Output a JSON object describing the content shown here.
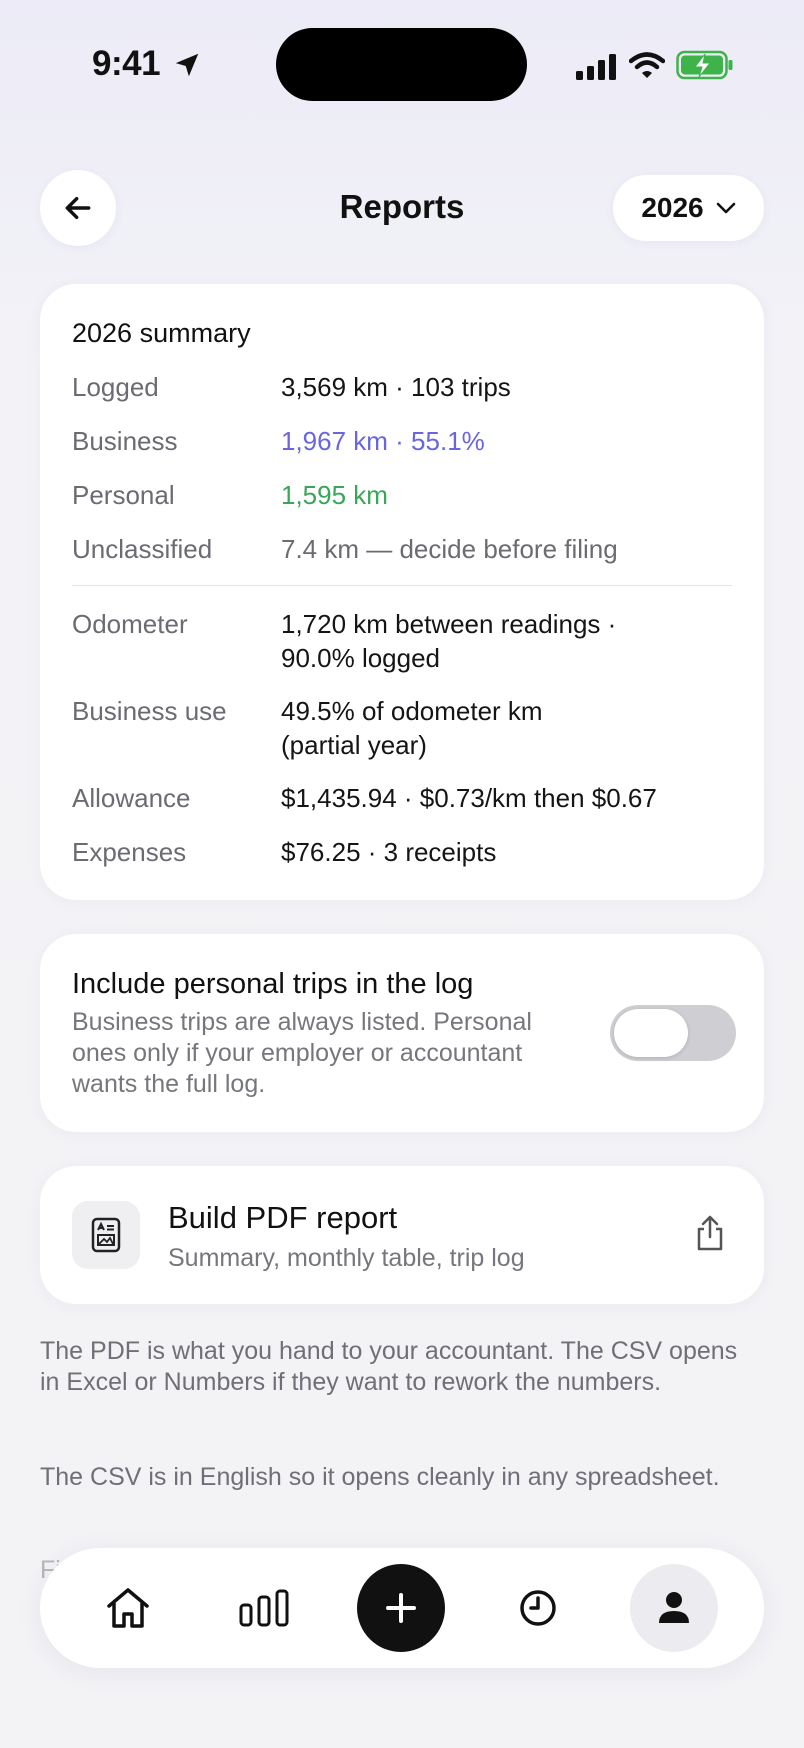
{
  "status_bar": {
    "time": "9:41"
  },
  "header": {
    "title": "Reports",
    "year": "2026"
  },
  "summary": {
    "title": "2026 summary",
    "rows": [
      {
        "label": "Logged",
        "value": "3,569 km · 103 trips"
      },
      {
        "label": "Business",
        "value": "1,967 km · 55.1%"
      },
      {
        "label": "Personal",
        "value": "1,595 km"
      },
      {
        "label": "Unclassified",
        "value": "7.4 km — decide before filing"
      },
      {
        "label": "Odometer",
        "value": "1,720 km between readings · 90.0% logged"
      },
      {
        "label": "Business use",
        "value": "49.5% of odometer km (partial year)"
      },
      {
        "label": "Allowance",
        "value": "$1,435.94 · $0.73/km then $0.67"
      },
      {
        "label": "Expenses",
        "value": "$76.25 · 3 receipts"
      }
    ],
    "colors": {
      "business": "#6a66dd",
      "personal": "#3aa657"
    }
  },
  "personal_toggle": {
    "title": "Include personal trips in the log",
    "description": "Business trips are always listed. Personal ones only if your employer or accountant wants the full log.",
    "enabled": false
  },
  "pdf_report": {
    "title": "Build PDF report",
    "subtitle": "Summary, monthly table, trip log",
    "icon": "document-icon",
    "action_icon": "share-icon"
  },
  "footnotes": [
    "The PDF is what you hand to your accountant. The CSV opens in Excel or Numbers if they want to rework the numbers.",
    "The CSV is in English so it opens cleanly in any spreadsheet.",
    "Fi"
  ],
  "tab_bar": {
    "items": [
      "home-icon",
      "stats-icon",
      "add-icon",
      "history-icon",
      "profile-icon"
    ],
    "active": "profile-icon"
  }
}
